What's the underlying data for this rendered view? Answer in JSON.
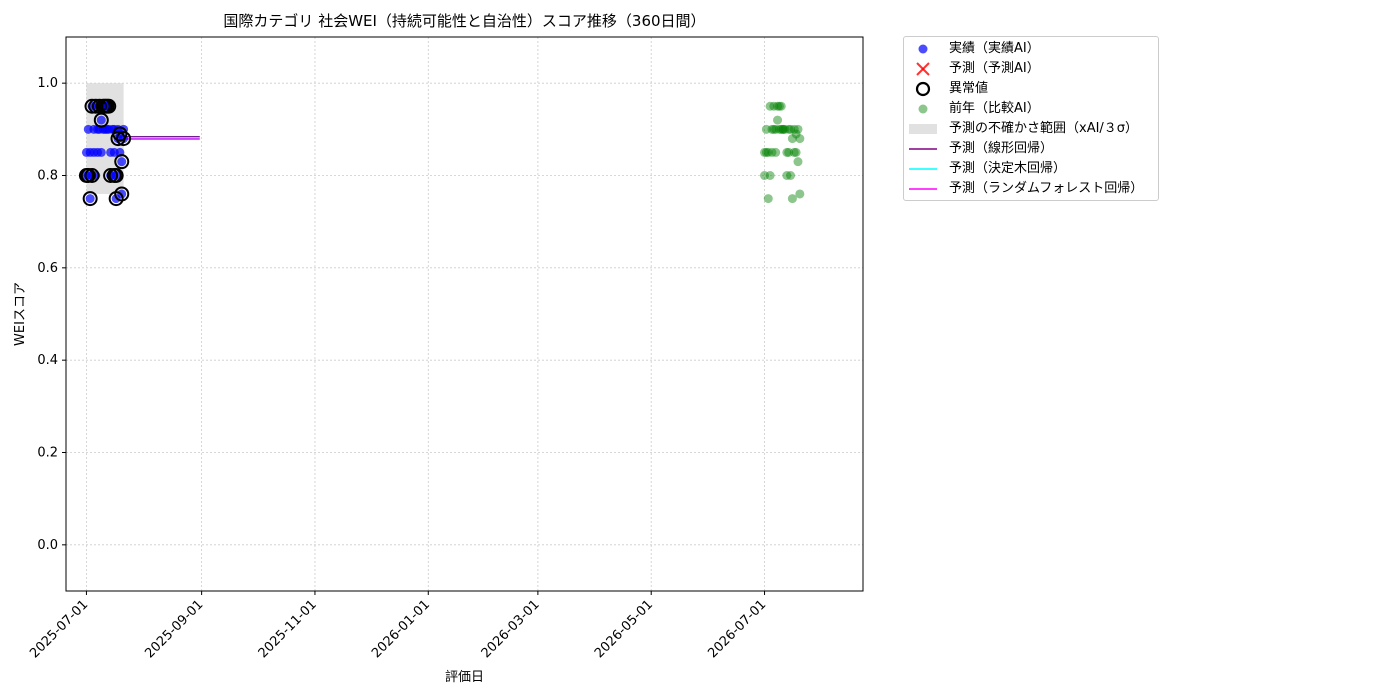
{
  "chart_data": {
    "type": "scatter",
    "title": "国際カテゴリ 社会WEI（持続可能性と自治性）スコア推移（360日間）",
    "xlabel": "評価日",
    "ylabel": "WEIスコア",
    "xlim": [
      "2025-06-20",
      "2026-08-23"
    ],
    "ylim": [
      -0.1,
      1.1
    ],
    "y_ticks": [
      "0.0",
      "0.2",
      "0.4",
      "0.6",
      "0.8",
      "1.0"
    ],
    "x_ticks": [
      "2025-07-01",
      "2025-09-01",
      "2025-11-01",
      "2026-01-01",
      "2026-03-01",
      "2026-05-01",
      "2026-07-01"
    ],
    "grid": true,
    "legend_position": "outside-right",
    "colors": {
      "actual": "#0000ff",
      "forecast": "#ff0000",
      "anomaly_edge": "#000000",
      "previous_year": "#008000",
      "uncertainty": "#d9d9d9",
      "linear": "#800080",
      "decision_tree": "#00ffff",
      "random_forest": "#ff00ff"
    },
    "legend": [
      {
        "key": "actual",
        "label": "実績（実績AI）"
      },
      {
        "key": "forecast",
        "label": "予測（予測AI）"
      },
      {
        "key": "anomaly",
        "label": "異常値"
      },
      {
        "key": "previous_year",
        "label": "前年（比較AI）"
      },
      {
        "key": "uncertainty",
        "label": "予測の不確かさ範囲（xAI/３σ）"
      },
      {
        "key": "linear",
        "label": "予測（線形回帰）"
      },
      {
        "key": "decision_tree",
        "label": "予測（決定木回帰）"
      },
      {
        "key": "random_forest",
        "label": "予測（ランダムフォレスト回帰）"
      }
    ],
    "series": [
      {
        "name": "実績（実績AI）",
        "points": [
          [
            "2025-07-01",
            0.8
          ],
          [
            "2025-07-01",
            0.85
          ],
          [
            "2025-07-02",
            0.9
          ],
          [
            "2025-07-02",
            0.8
          ],
          [
            "2025-07-03",
            0.85
          ],
          [
            "2025-07-03",
            0.75
          ],
          [
            "2025-07-04",
            0.8
          ],
          [
            "2025-07-04",
            0.95
          ],
          [
            "2025-07-05",
            0.85
          ],
          [
            "2025-07-05",
            0.9
          ],
          [
            "2025-07-06",
            0.95
          ],
          [
            "2025-07-06",
            0.8
          ],
          [
            "2025-07-07",
            0.9
          ],
          [
            "2025-07-07",
            0.85
          ],
          [
            "2025-07-08",
            0.95
          ],
          [
            "2025-07-08",
            0.9
          ],
          [
            "2025-07-09",
            0.92
          ],
          [
            "2025-07-09",
            0.85
          ],
          [
            "2025-07-10",
            0.95
          ],
          [
            "2025-07-10",
            0.9
          ],
          [
            "2025-07-11",
            0.95
          ],
          [
            "2025-07-11",
            0.9
          ],
          [
            "2025-07-12",
            0.95
          ],
          [
            "2025-07-12",
            0.9
          ],
          [
            "2025-07-13",
            0.95
          ],
          [
            "2025-07-13",
            0.9
          ],
          [
            "2025-07-14",
            0.8
          ],
          [
            "2025-07-14",
            0.85
          ],
          [
            "2025-07-15",
            0.9
          ],
          [
            "2025-07-15",
            0.8
          ],
          [
            "2025-07-16",
            0.85
          ],
          [
            "2025-07-16",
            0.9
          ],
          [
            "2025-07-17",
            0.8
          ],
          [
            "2025-07-17",
            0.75
          ],
          [
            "2025-07-18",
            0.88
          ],
          [
            "2025-07-18",
            0.9
          ],
          [
            "2025-07-19",
            0.89
          ],
          [
            "2025-07-19",
            0.85
          ],
          [
            "2025-07-20",
            0.83
          ],
          [
            "2025-07-20",
            0.76
          ],
          [
            "2025-07-21",
            0.88
          ],
          [
            "2025-07-21",
            0.9
          ]
        ]
      },
      {
        "name": "異常値",
        "points": [
          [
            "2025-07-01",
            0.8
          ],
          [
            "2025-07-02",
            0.8
          ],
          [
            "2025-07-03",
            0.75
          ],
          [
            "2025-07-04",
            0.8
          ],
          [
            "2025-07-04",
            0.95
          ],
          [
            "2025-07-06",
            0.95
          ],
          [
            "2025-07-08",
            0.95
          ],
          [
            "2025-07-09",
            0.92
          ],
          [
            "2025-07-10",
            0.95
          ],
          [
            "2025-07-11",
            0.95
          ],
          [
            "2025-07-12",
            0.95
          ],
          [
            "2025-07-13",
            0.95
          ],
          [
            "2025-07-14",
            0.8
          ],
          [
            "2025-07-16",
            0.8
          ],
          [
            "2025-07-17",
            0.8
          ],
          [
            "2025-07-17",
            0.75
          ],
          [
            "2025-07-18",
            0.88
          ],
          [
            "2025-07-19",
            0.89
          ],
          [
            "2025-07-20",
            0.83
          ],
          [
            "2025-07-20",
            0.76
          ],
          [
            "2025-07-21",
            0.88
          ]
        ]
      },
      {
        "name": "前年（比較AI）",
        "points": [
          [
            "2026-07-01",
            0.85
          ],
          [
            "2026-07-01",
            0.8
          ],
          [
            "2026-07-02",
            0.9
          ],
          [
            "2026-07-02",
            0.85
          ],
          [
            "2026-07-03",
            0.75
          ],
          [
            "2026-07-03",
            0.85
          ],
          [
            "2026-07-04",
            0.8
          ],
          [
            "2026-07-04",
            0.95
          ],
          [
            "2026-07-05",
            0.9
          ],
          [
            "2026-07-05",
            0.85
          ],
          [
            "2026-07-06",
            0.95
          ],
          [
            "2026-07-06",
            0.9
          ],
          [
            "2026-07-07",
            0.85
          ],
          [
            "2026-07-07",
            0.9
          ],
          [
            "2026-07-08",
            0.95
          ],
          [
            "2026-07-08",
            0.92
          ],
          [
            "2026-07-09",
            0.9
          ],
          [
            "2026-07-09",
            0.95
          ],
          [
            "2026-07-10",
            0.95
          ],
          [
            "2026-07-10",
            0.9
          ],
          [
            "2026-07-11",
            0.9
          ],
          [
            "2026-07-11",
            0.9
          ],
          [
            "2026-07-12",
            0.9
          ],
          [
            "2026-07-13",
            0.8
          ],
          [
            "2026-07-13",
            0.85
          ],
          [
            "2026-07-14",
            0.9
          ],
          [
            "2026-07-14",
            0.85
          ],
          [
            "2026-07-15",
            0.9
          ],
          [
            "2026-07-15",
            0.8
          ],
          [
            "2026-07-16",
            0.75
          ],
          [
            "2026-07-16",
            0.88
          ],
          [
            "2026-07-17",
            0.9
          ],
          [
            "2026-07-17",
            0.85
          ],
          [
            "2026-07-18",
            0.89
          ],
          [
            "2026-07-18",
            0.85
          ],
          [
            "2026-07-19",
            0.83
          ],
          [
            "2026-07-19",
            0.9
          ],
          [
            "2026-07-20",
            0.76
          ],
          [
            "2026-07-20",
            0.88
          ]
        ]
      }
    ],
    "uncertainty_band": {
      "x": [
        "2025-07-01",
        "2025-07-21"
      ],
      "y": [
        0.76,
        1.0
      ]
    },
    "forecast_lines": [
      {
        "name": "予測（線形回帰）",
        "x": [
          "2025-07-21",
          "2025-08-31"
        ],
        "y": [
          0.884,
          0.884
        ]
      },
      {
        "name": "予測（決定木回帰）",
        "x": [
          "2025-07-21",
          "2025-08-31"
        ],
        "y": [
          0.882,
          0.882
        ]
      },
      {
        "name": "予測（ランダムフォレスト回帰）",
        "x": [
          "2025-07-21",
          "2025-08-31"
        ],
        "y": [
          0.879,
          0.879
        ]
      }
    ]
  }
}
